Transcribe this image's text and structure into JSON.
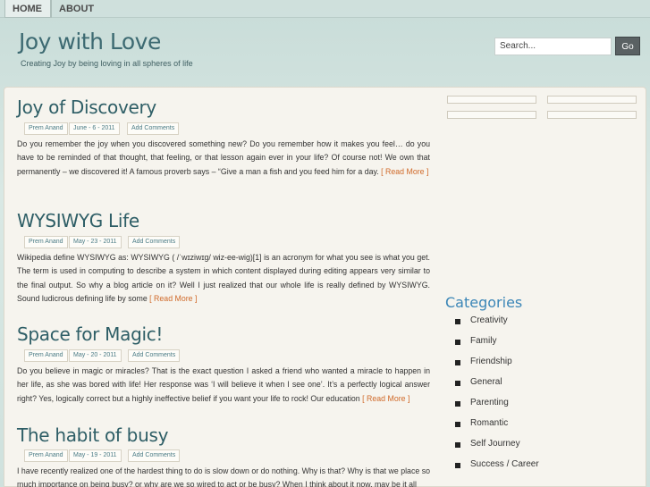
{
  "nav": {
    "home": "HOME",
    "about": "ABOUT"
  },
  "site": {
    "title": "Joy with Love",
    "tagline": "Creating Joy by being loving in all spheres of life"
  },
  "search": {
    "value": "Search...",
    "button": "Go"
  },
  "posts": [
    {
      "title": "Joy of Discovery",
      "author": "Prem Anand",
      "date": "June - 6 - 2011",
      "comments": "Add Comments",
      "excerpt": "Do you remember the joy when you discovered something new?  Do you remember how it makes you feel… do you have to be reminded of that thought, that feeling, or that lesson again ever  in your life? Of course not! We own that  permanently – we discovered it! A famous proverb says – “Give a man a fish and you feed him for a day. ",
      "readmore": "[ Read More ]"
    },
    {
      "title": "WYSIWYG Life",
      "author": "Prem Anand",
      "date": "May - 23 - 2011",
      "comments": "Add Comments",
      "excerpt": "Wikipedia define WYSIWYG as: WYSIWYG ( /ˈwɪziwɪɡ/ wiz-ee-wig)[1] is an acronym for what you see is what you get. The term is used in computing to describe a system in which content displayed during editing appears very similar to the final output. So why a blog article on it? Well I just realized that our whole life is really defined by WYSIWYG. Sound ludicrous defining life by some ",
      "readmore": "[ Read More ]"
    },
    {
      "title": "Space for Magic!",
      "author": "Prem Anand",
      "date": "May - 20 - 2011",
      "comments": "Add Comments",
      "excerpt": "Do you believe in magic or miracles? That is the exact question I asked a friend who wanted a miracle to happen in her life, as she was bored with life! Her response was ‘I will believe it when I see one’. It’s a perfectly logical answer right? Yes, logically correct but a highly ineffective belief if you want your life to rock! Our education ",
      "readmore": "[ Read More ]"
    },
    {
      "title": "The habit of busy",
      "author": "Prem Anand",
      "date": "May - 19 - 2011",
      "comments": "Add Comments",
      "excerpt": "I have recently realized one of the hardest thing to do is slow down or do nothing.  Why is that? Why is that we place so much importance on being busy? or why are we so wired to act or be busy? When I think about it now, may be it all",
      "readmore": ""
    }
  ],
  "sidebar": {
    "categories_heading": "Categories",
    "categories": [
      "Creativity",
      "Family",
      "Friendship",
      "General",
      "Parenting",
      "Romantic",
      "Self Journey",
      "Success / Career"
    ]
  }
}
